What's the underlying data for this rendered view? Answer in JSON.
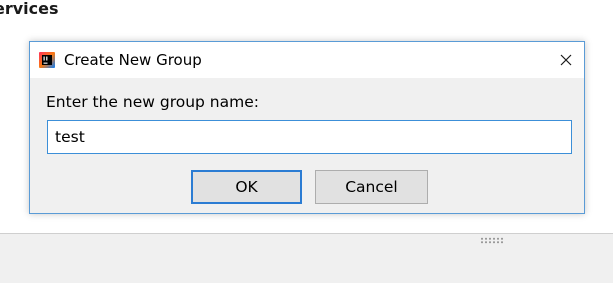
{
  "background": {
    "section_title": "ervices"
  },
  "dialog": {
    "title": "Create New Group",
    "prompt": "Enter the new group name:",
    "input_value": "test",
    "ok_label": "OK",
    "cancel_label": "Cancel",
    "app_icon": "intellij-idea-icon",
    "close_icon": "close-icon"
  },
  "colors": {
    "accent_blue": "#2b7cd3",
    "dialog_bg": "#f0f0f0",
    "titlebar_bg": "#ffffff"
  }
}
